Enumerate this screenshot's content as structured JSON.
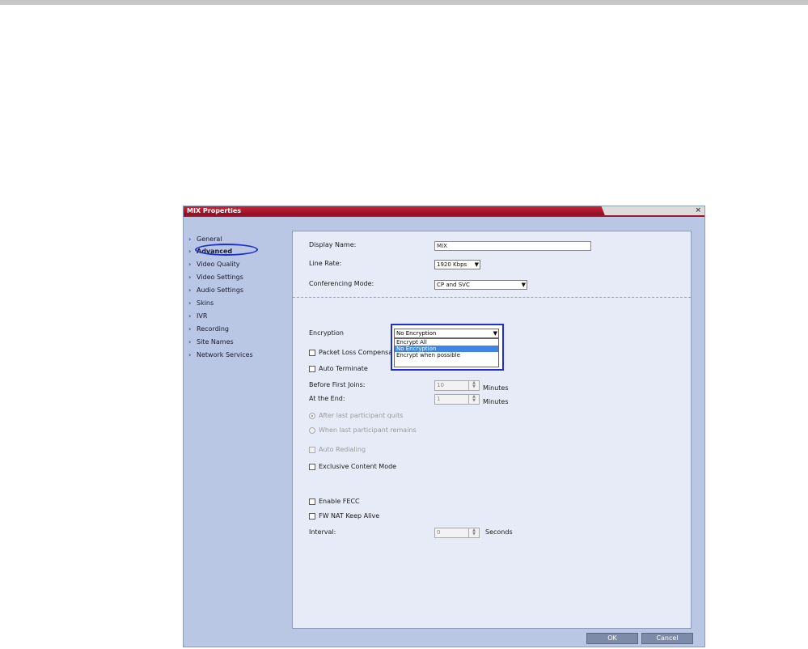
{
  "window": {
    "title": "MIX Properties",
    "close_label": "×"
  },
  "sidebar": {
    "items": [
      {
        "label": "General"
      },
      {
        "label": "Advanced",
        "active": true
      },
      {
        "label": "Video Quality"
      },
      {
        "label": "Video Settings"
      },
      {
        "label": "Audio Settings"
      },
      {
        "label": "Skins"
      },
      {
        "label": "IVR"
      },
      {
        "label": "Recording"
      },
      {
        "label": "Site Names"
      },
      {
        "label": "Network Services"
      }
    ]
  },
  "form": {
    "display_name": {
      "label": "Display Name:",
      "value": "MIX"
    },
    "line_rate": {
      "label": "Line Rate:",
      "value": "1920 Kbps"
    },
    "conferencing_mode": {
      "label": "Conferencing Mode:",
      "value": "CP and SVC"
    },
    "encryption": {
      "label": "Encryption",
      "value": "No Encryption",
      "options": [
        "Encrypt All",
        "No Encryption",
        "Encrypt when possible"
      ],
      "highlighted": "No Encryption"
    },
    "packet_loss": {
      "label": "Packet Loss Compensation"
    },
    "auto_terminate": {
      "label": "Auto Terminate"
    },
    "before_first_joins": {
      "label": "Before First Joins:",
      "value": "10",
      "unit": "Minutes"
    },
    "at_the_end": {
      "label": "At the End:",
      "value": "1",
      "unit": "Minutes"
    },
    "radio_after_last": {
      "label": "After last participant quits"
    },
    "radio_when_last": {
      "label": "When last participant remains"
    },
    "auto_redialing": {
      "label": "Auto Redialing"
    },
    "exclusive_content": {
      "label": "Exclusive Content Mode"
    },
    "enable_fecc": {
      "label": "Enable FECC"
    },
    "fw_nat": {
      "label": "FW NAT Keep Alive"
    },
    "interval": {
      "label": "Interval:",
      "value": "0",
      "unit": "Seconds"
    }
  },
  "buttons": {
    "ok": "OK",
    "cancel": "Cancel"
  },
  "colors": {
    "title_bar": "#c8243a",
    "sidebar": "#b9c7e4",
    "panel": "#e6ebf7",
    "highlight": "#1d2fd0"
  }
}
